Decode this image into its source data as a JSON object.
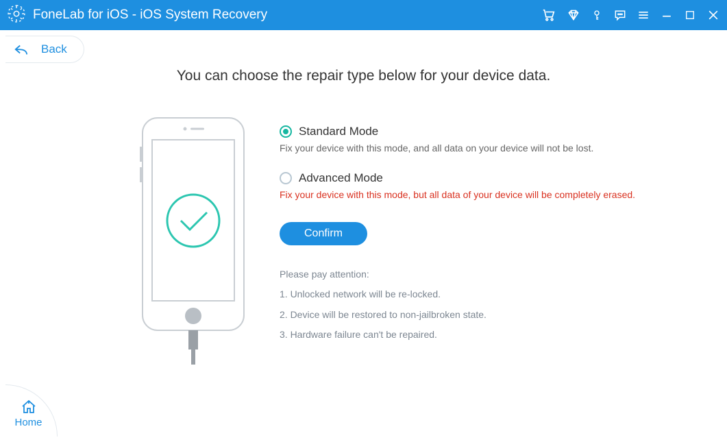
{
  "titlebar": {
    "title": "FoneLab for iOS - iOS System Recovery"
  },
  "back": {
    "label": "Back"
  },
  "heading": "You can choose the repair type below for your device data.",
  "options": {
    "standard": {
      "label": "Standard Mode",
      "desc": "Fix your device with this mode, and all data on your device will not be lost."
    },
    "advanced": {
      "label": "Advanced Mode",
      "desc": "Fix your device with this mode, but all data of your device will be completely erased."
    }
  },
  "confirm": {
    "label": "Confirm"
  },
  "attention": {
    "title": "Please pay attention:",
    "item1": "1. Unlocked network will be re-locked.",
    "item2": "2. Device will be restored to non-jailbroken state.",
    "item3": "3. Hardware failure can't be repaired."
  },
  "home": {
    "label": "Home"
  }
}
